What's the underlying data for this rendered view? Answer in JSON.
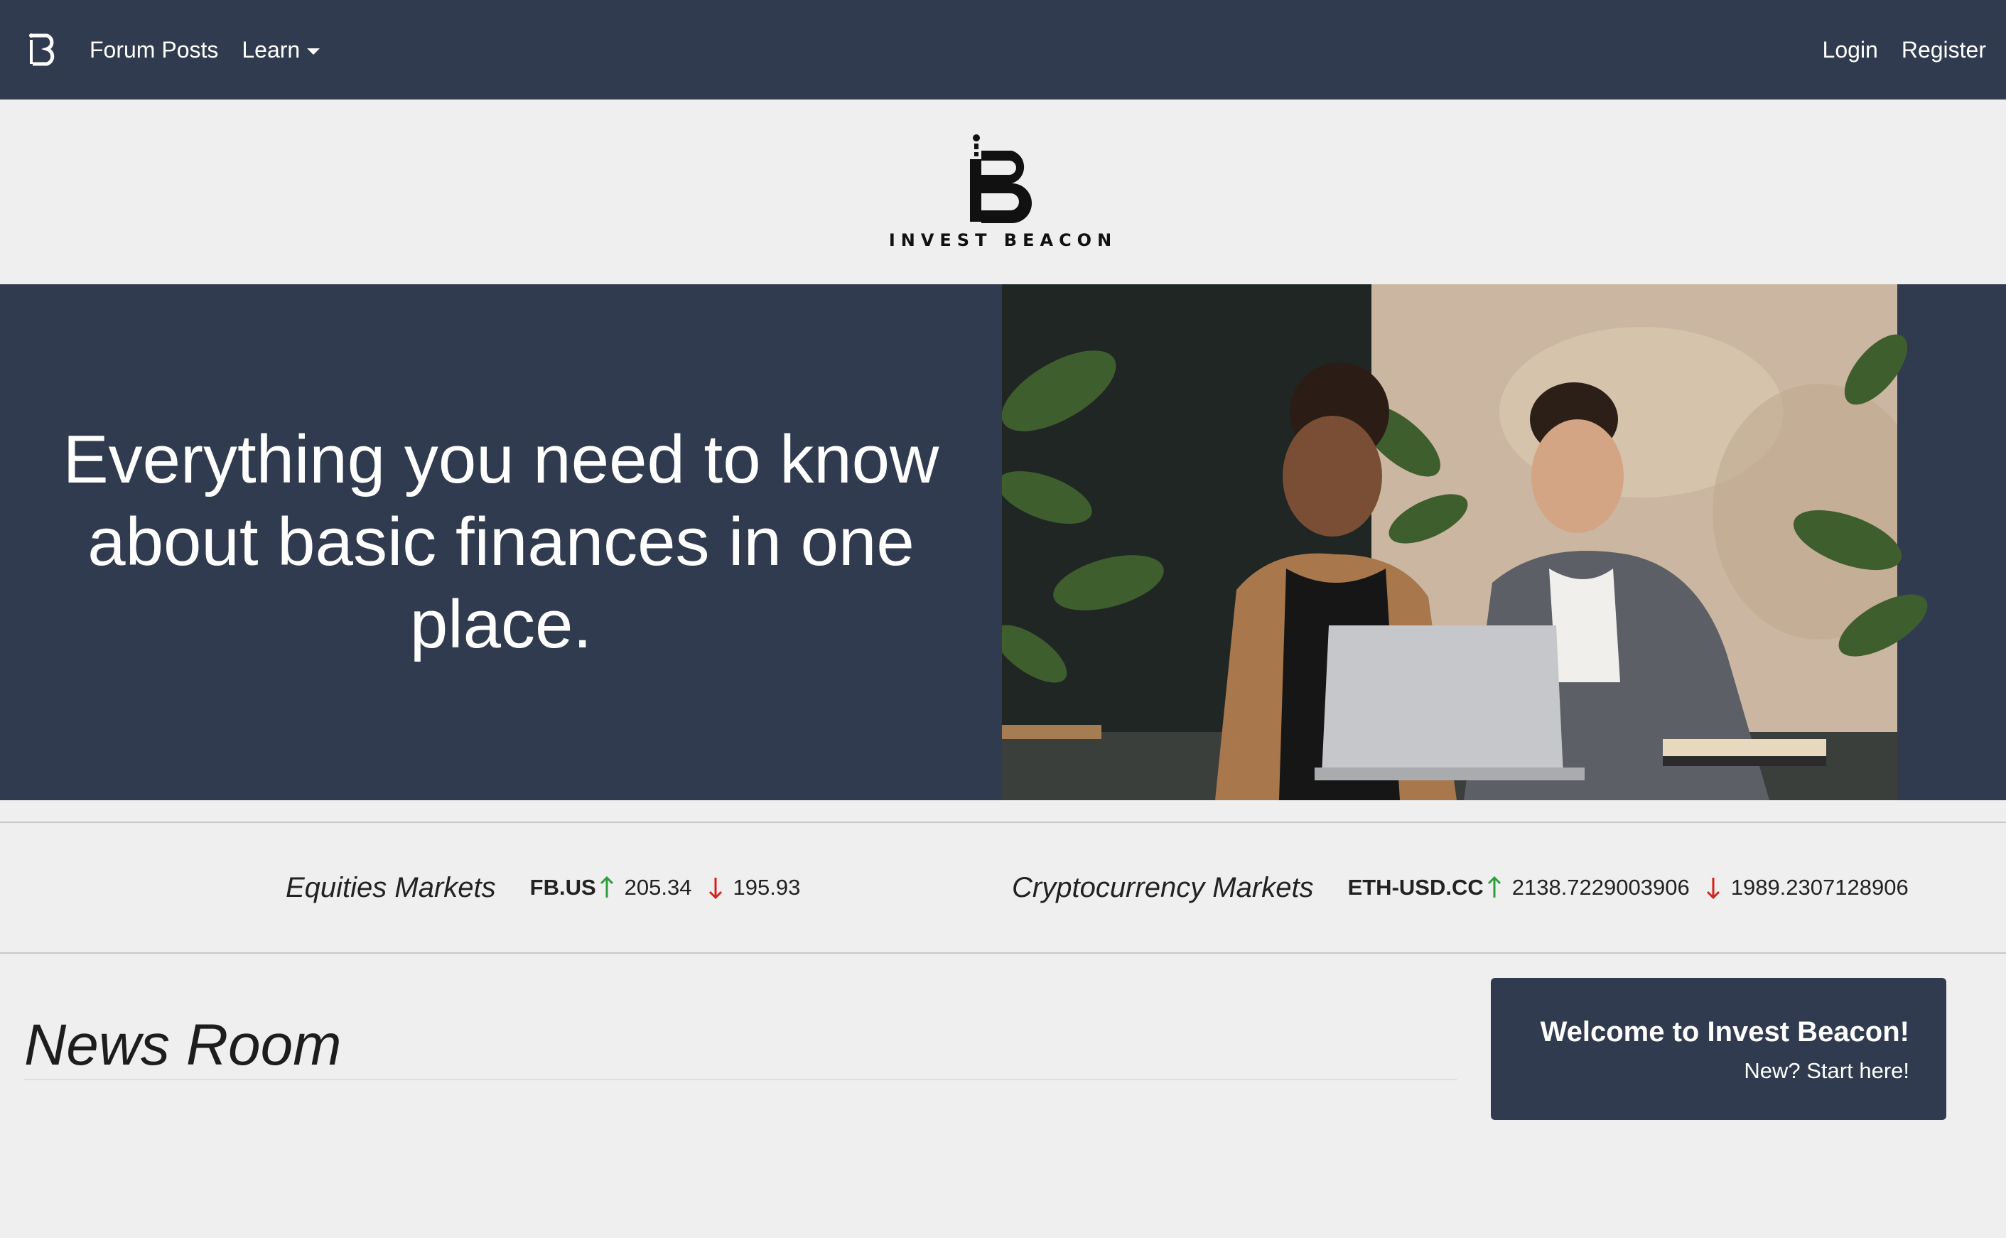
{
  "brand": {
    "name": "INVEST BEACON",
    "logo_icon": "ib-logo-icon"
  },
  "navbar": {
    "links": {
      "forum_posts": "Forum Posts",
      "learn": "Learn"
    },
    "auth": {
      "login": "Login",
      "register": "Register"
    }
  },
  "hero": {
    "title": "Everything you need to know about basic finances in one place.",
    "image_icon": "hero-photo-two-people-at-laptop"
  },
  "markets": {
    "equities": {
      "title": "Equities Markets",
      "symbol": "FB.US",
      "high": "205.34",
      "low": "195.93"
    },
    "crypto": {
      "title": "Cryptocurrency Markets",
      "symbol": "ETH-USD.CC",
      "high": "2138.7229003906",
      "low": "1989.2307128906"
    },
    "colors": {
      "up": "#2e9e3e",
      "down": "#d6231b"
    }
  },
  "news": {
    "title": "News Room"
  },
  "welcome": {
    "title": "Welcome to Invest Beacon!",
    "subtitle": "New? Start here!"
  },
  "colors": {
    "navy": "#303b4f",
    "background": "#efefef"
  }
}
